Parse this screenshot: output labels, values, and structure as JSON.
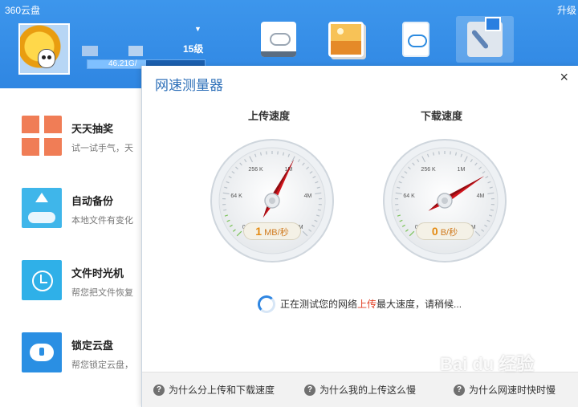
{
  "app": {
    "title": "360云盘",
    "upgrade_label": "升级"
  },
  "user": {
    "level": "15级",
    "quota_text": "46.21G/",
    "quota_fraction": 0.5,
    "dropdown_glyph": "▼"
  },
  "nav_tabs": [
    {
      "name": "cloud-drive",
      "icon": "cloud-drive-icon"
    },
    {
      "name": "photos",
      "icon": "photo-icon"
    },
    {
      "name": "mobile",
      "icon": "tablet-cloud-icon"
    },
    {
      "name": "toolbox",
      "icon": "toolbox-icon",
      "active": true
    }
  ],
  "features": [
    {
      "title": "天天抽奖",
      "desc": "试一试手气，天",
      "icon": "gift-icon",
      "color": "#f07d56"
    },
    {
      "title": "自动备份",
      "desc": "本地文件有变化",
      "icon": "cloud-upload-icon",
      "color": "#3fb6ea"
    },
    {
      "title": "文件时光机",
      "desc": "帮您把文件恢复",
      "icon": "history-clock-icon",
      "color": "#2fb0e8"
    },
    {
      "title": "锁定云盘",
      "desc": "帮您锁定云盘，",
      "icon": "cloud-lock-icon",
      "color": "#2a8fe3"
    }
  ],
  "dialog": {
    "title": "网速测量器",
    "close_glyph": "×",
    "upload": {
      "label": "上传速度",
      "value": "1",
      "unit": "MB/秒",
      "ticks": [
        "0 K",
        "64 K",
        "256 K",
        "1M",
        "4M",
        "16M"
      ]
    },
    "download": {
      "label": "下载速度",
      "value": "0",
      "unit": "B/秒",
      "ticks": [
        "0 K",
        "64 K",
        "256 K",
        "1M",
        "4M",
        "16M"
      ]
    },
    "status_prefix": "正在测试您的网络",
    "status_highlight": "上传",
    "status_suffix": "最大速度，请稍候...",
    "help_links": [
      "为什么分上传和下载速度",
      "为什么我的上传这么慢",
      "为什么网速时快时慢"
    ]
  },
  "watermark": "Bai du 经验",
  "colors": {
    "header": "#2f86e2",
    "accent_title": "#2d6fb8",
    "needle": "#d0141c",
    "speed_value": "#e48a10"
  }
}
